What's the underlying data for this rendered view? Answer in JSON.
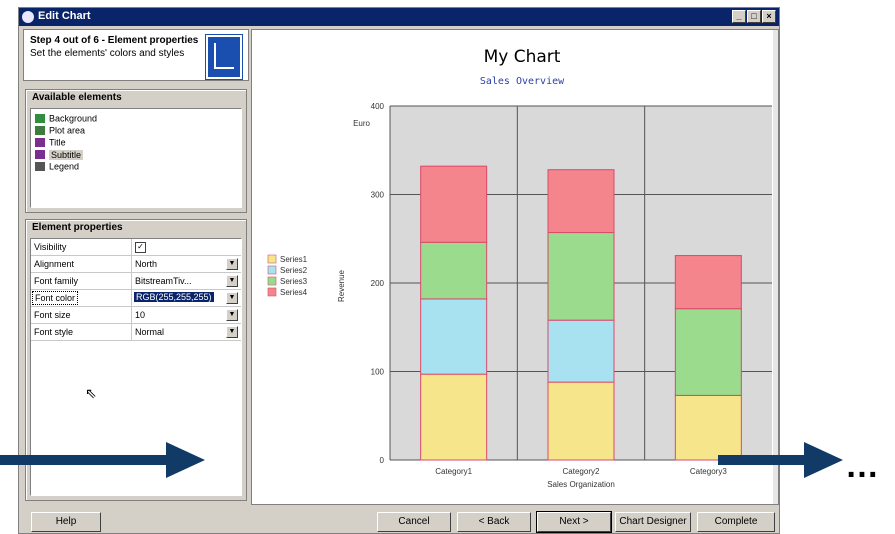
{
  "window": {
    "title": "Edit Chart",
    "buttons": [
      "minimize",
      "maximize",
      "close"
    ]
  },
  "wizard": {
    "step_title": "Step 4 out of 6 - Element properties",
    "step_subtitle": "Set the elements' colors and styles"
  },
  "elements": {
    "label": "Available elements",
    "items": [
      {
        "label": "Background",
        "icon": "background-icon",
        "color": "#2f8f3f"
      },
      {
        "label": "Plot area",
        "icon": "plot-area-icon",
        "color": "#3e7c3e"
      },
      {
        "label": "Title",
        "icon": "title-icon",
        "color": "#7a2f8f"
      },
      {
        "label": "Subtitle",
        "icon": "subtitle-icon",
        "color": "#7a2f8f",
        "selected": true
      },
      {
        "label": "Legend",
        "icon": "legend-icon",
        "color": "#555555"
      }
    ]
  },
  "properties": {
    "label": "Element properties",
    "rows": [
      {
        "name": "Visibility",
        "value": "☑",
        "type": "checkbox"
      },
      {
        "name": "Alignment",
        "value": "North",
        "type": "dropdown"
      },
      {
        "name": "Font family",
        "value": "BitstreamTiv...",
        "type": "dropdown"
      },
      {
        "name": "Font color",
        "value": "RGB(255,255,255)",
        "type": "dropdown",
        "selected": true
      },
      {
        "name": "Font size",
        "value": "10",
        "type": "dropdown"
      },
      {
        "name": "Font style",
        "value": "Normal",
        "type": "dropdown"
      }
    ]
  },
  "chart_data": {
    "type": "bar",
    "stacked": true,
    "title": "My Chart",
    "subtitle": "Sales Overview",
    "xlabel": "Sales Organization",
    "ylabel": "Revenue",
    "yunit": "Euro",
    "ylim": [
      0,
      400
    ],
    "yticks": [
      0,
      100,
      200,
      300,
      400
    ],
    "grid": true,
    "legend_position": "left",
    "categories": [
      "Category1",
      "Category2",
      "Category3"
    ],
    "series": [
      {
        "name": "Series1",
        "color": "#f7e58c",
        "values": [
          97,
          88,
          73
        ]
      },
      {
        "name": "Series2",
        "color": "#a8e1f0",
        "values": [
          85,
          70,
          0
        ]
      },
      {
        "name": "Series3",
        "color": "#9adb8e",
        "values": [
          64,
          99,
          98
        ]
      },
      {
        "name": "Series4",
        "color": "#f4858c",
        "values": [
          86,
          71,
          60
        ]
      }
    ],
    "colors": {
      "plot_bg": "#d9d9d9",
      "grid": "#555555",
      "bar_border": "#d84a6a"
    }
  },
  "footer": {
    "help": "Help",
    "cancel": "Cancel",
    "back": "< Back",
    "next": "Next >",
    "designer": "Chart Designer",
    "complete": "Complete"
  },
  "overlay": {
    "ellipsis": "…",
    "arrow_color": "#123a66"
  }
}
